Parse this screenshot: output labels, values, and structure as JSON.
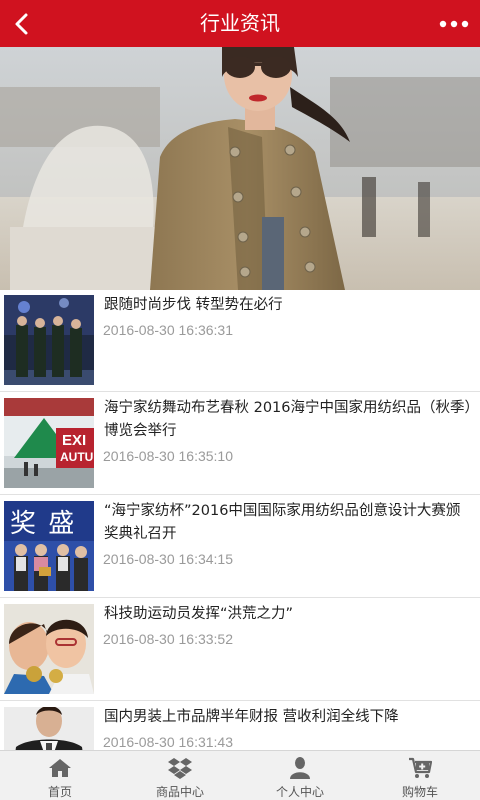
{
  "header": {
    "title": "行业资讯",
    "back_icon": "chevron-left-icon",
    "more_icon": "more-dots-icon",
    "background": "#d0121f"
  },
  "news": [
    {
      "title": "跟随时尚步伐 转型势在必行",
      "time": "2016-08-30 16:36:31"
    },
    {
      "title": "海宁家纺舞动布艺春秋 2016海宁中国家用纺织品（秋季）博览会举行",
      "time": "2016-08-30 16:35:10"
    },
    {
      "title": "“海宁家纺杯”2016中国国际家用纺织品创意设计大赛颁奖典礼召开",
      "time": "2016-08-30 16:34:15"
    },
    {
      "title": "科技助运动员发挥“洪荒之力”",
      "time": "2016-08-30 16:33:52"
    },
    {
      "title": "国内男装上市品牌半年财报 营收利润全线下降",
      "time": "2016-08-30 16:31:43"
    }
  ],
  "thumb_text": {
    "exhibition_sign_1": "EXI",
    "exhibition_sign_2": "AUTU",
    "award_banner": "奖 盛"
  },
  "tabbar": [
    {
      "label": "首页",
      "icon": "home-icon"
    },
    {
      "label": "商品中心",
      "icon": "dropbox-icon"
    },
    {
      "label": "个人中心",
      "icon": "user-icon"
    },
    {
      "label": "购物车",
      "icon": "cart-icon"
    }
  ]
}
